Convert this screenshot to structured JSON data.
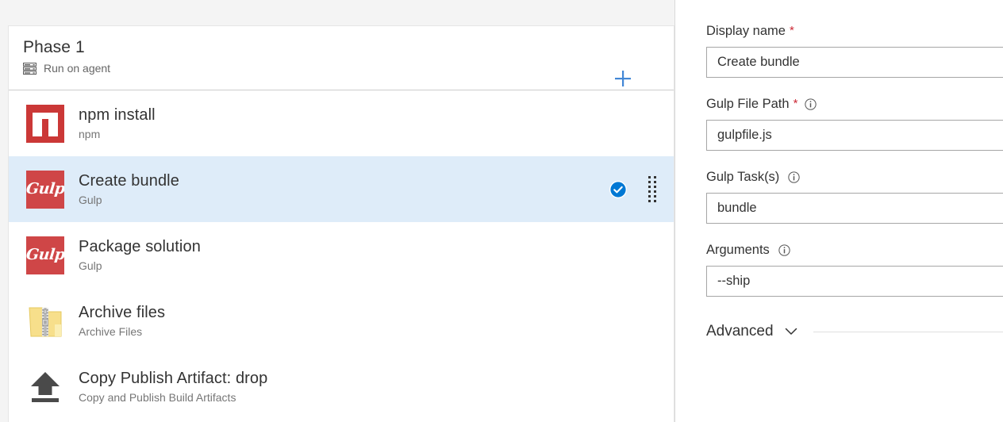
{
  "left_pane": {
    "phase": {
      "title": "Phase 1",
      "subtitle": "Run on agent",
      "agent_icon": "server-rack-icon",
      "add_button_icon": "plus-icon"
    },
    "tasks": [
      {
        "name": "npm install",
        "sub": "npm",
        "icon": "npm-icon",
        "selected": false,
        "enabled_icon": null,
        "drag_icon": null
      },
      {
        "name": "Create bundle",
        "sub": "Gulp",
        "icon": "gulp-icon",
        "icon_text": "Gulp",
        "selected": true,
        "enabled_icon": "check-circle-icon",
        "drag_icon": "drag-handle-icon"
      },
      {
        "name": "Package solution",
        "sub": "Gulp",
        "icon": "gulp-icon",
        "icon_text": "Gulp",
        "selected": false,
        "enabled_icon": null,
        "drag_icon": null
      },
      {
        "name": "Archive files",
        "sub": "Archive Files",
        "icon": "zip-folder-icon",
        "selected": false,
        "enabled_icon": null,
        "drag_icon": null
      },
      {
        "name": "Copy Publish Artifact: drop",
        "sub": "Copy and Publish Build Artifacts",
        "icon": "upload-arrow-icon",
        "selected": false,
        "enabled_icon": null,
        "drag_icon": null
      }
    ]
  },
  "right_pane": {
    "fields": [
      {
        "label": "Display name",
        "required": true,
        "has_info": false,
        "value": "Create bundle",
        "placeholder": "Display name",
        "name": "display-name"
      },
      {
        "label": "Gulp File Path",
        "required": true,
        "has_info": true,
        "value": "gulpfile.js",
        "placeholder": "Gulp File Path",
        "name": "gulp-file-path"
      },
      {
        "label": "Gulp Task(s)",
        "required": false,
        "has_info": true,
        "value": "bundle",
        "placeholder": "Gulp Task(s)",
        "name": "gulp-tasks"
      },
      {
        "label": "Arguments",
        "required": false,
        "has_info": true,
        "value": "--ship",
        "placeholder": "Arguments",
        "name": "arguments"
      }
    ],
    "advanced": {
      "label": "Advanced",
      "chevron_icon": "chevron-down-icon"
    }
  },
  "colors": {
    "accent_blue": "#0078d4",
    "selected_row": "#deecf9",
    "npm_red": "#cb3837",
    "gulp_red": "#cf4647",
    "required_star": "#cc2936",
    "text_primary": "#333333",
    "text_secondary": "#767676"
  },
  "symbols": {
    "required_star": "*"
  }
}
